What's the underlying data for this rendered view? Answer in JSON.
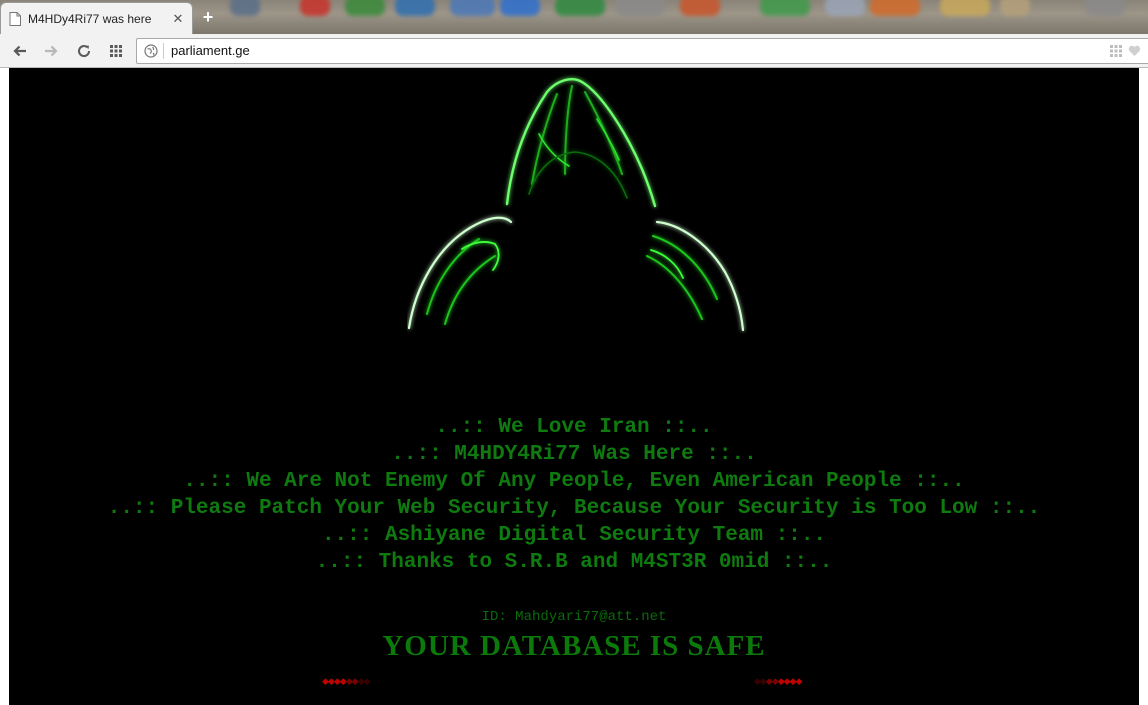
{
  "browser": {
    "tab": {
      "title": "M4HDy4Ri77 was here",
      "close_glyph": "✕"
    },
    "new_tab_glyph": "+",
    "address": {
      "url": "parliament.ge"
    },
    "icons": {
      "back": "arrow-left-icon",
      "forward": "arrow-right-icon",
      "reload": "reload-icon",
      "apps": "apps-grid-icon",
      "site_info": "globe-icon",
      "bookmark": "heart-icon"
    }
  },
  "page": {
    "messages": [
      "..:: We Love Iran ::..",
      "..:: M4HDY4Ri77 Was Here ::..",
      "..:: We Are Not Enemy Of Any People, Even American People ::..",
      "..:: Please Patch Your Web Security, Because Your Security is Too Low ::..",
      "..:: Ashiyane Digital Security Team ::..",
      "..:: Thanks to S.R.B and M4ST3R 0mid ::.."
    ],
    "contact": "ID: Mahdyari77@att.net",
    "safe_notice": "YOUR DATABASE IS SAFE",
    "colors": {
      "text_green": "#0f7a0f",
      "background": "#000000",
      "dots_red": "#c00000"
    }
  }
}
